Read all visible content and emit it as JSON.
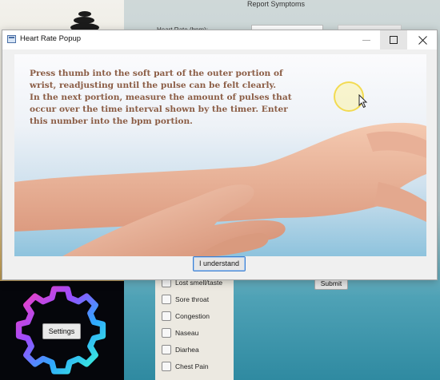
{
  "background_app": {
    "title": "Report Symptoms",
    "heart_rate_label": "Heart Rate (bpm):",
    "settings_button": "Settings",
    "submit_button": "Submit",
    "symptoms": [
      {
        "label": "Lost smell/taste"
      },
      {
        "label": "Sore throat"
      },
      {
        "label": "Congestion"
      },
      {
        "label": "Naseau"
      },
      {
        "label": "Diarhea"
      },
      {
        "label": "Chest Pain"
      }
    ]
  },
  "popup": {
    "title": "Heart Rate Popup",
    "window_controls": [
      "minimize-icon",
      "maximize-icon",
      "close-icon"
    ],
    "instruction_lines": [
      "Press thumb into the soft part of the outer portion of",
      "wrist, readjusting until the pulse can be felt clearly.",
      "In the next portion, measure the amount of pulses that",
      "occur over the time interval shown by the timer. Enter",
      "this number into the bpm portion."
    ],
    "confirm_button": "I understand",
    "instruction_color": "#8b5d45",
    "accent_color": "#3c7fd1"
  }
}
